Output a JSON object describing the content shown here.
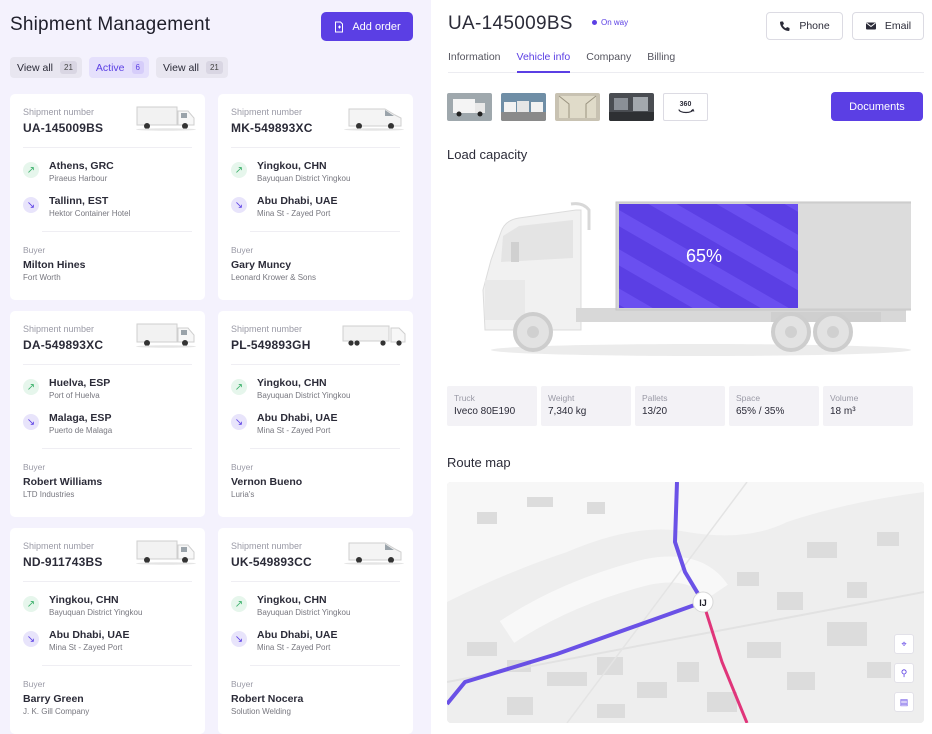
{
  "left": {
    "title": "Shipment Management",
    "add_order": "Add order",
    "filters": [
      {
        "label": "View all",
        "count": "21"
      },
      {
        "label": "Active",
        "count": "6"
      },
      {
        "label": "View all",
        "count": "21"
      }
    ],
    "shipment_label": "Shipment number",
    "buyer_label": "Buyer",
    "cards": [
      {
        "number": "UA-145009BS",
        "vehicle": "truck",
        "from_city": "Athens, GRC",
        "from_place": "Piraeus Harbour",
        "to_city": "Tallinn, EST",
        "to_place": "Hektor Container Hotel",
        "buyer": "Milton Hines",
        "company": "Fort Worth"
      },
      {
        "number": "MK-549893XC",
        "vehicle": "van",
        "from_city": "Yingkou, CHN",
        "from_place": "Bayuquan District Yingkou",
        "to_city": "Abu Dhabi, UAE",
        "to_place": "Mina St - Zayed Port",
        "buyer": "Gary Muncy",
        "company": "Leonard Krower & Sons"
      },
      {
        "number": "DA-549893XC",
        "vehicle": "truck",
        "from_city": "Huelva, ESP",
        "from_place": "Port of Huelva",
        "to_city": "Malaga, ESP",
        "to_place": "Puerto de Malaga",
        "buyer": "Robert Williams",
        "company": "LTD Industries"
      },
      {
        "number": "PL-549893GH",
        "vehicle": "semi",
        "from_city": "Yingkou, CHN",
        "from_place": "Bayuquan District Yingkou",
        "to_city": "Abu Dhabi, UAE",
        "to_place": "Mina St - Zayed Port",
        "buyer": "Vernon Bueno",
        "company": "Luria's"
      },
      {
        "number": "ND-911743BS",
        "vehicle": "truck",
        "from_city": "Yingkou, CHN",
        "from_place": "Bayuquan District Yingkou",
        "to_city": "Abu Dhabi, UAE",
        "to_place": "Mina St - Zayed Port",
        "buyer": "Barry Green",
        "company": "J. K. Gill Company"
      },
      {
        "number": "UK-549893CC",
        "vehicle": "van",
        "from_city": "Yingkou, CHN",
        "from_place": "Bayuquan District Yingkou",
        "to_city": "Abu Dhabi, UAE",
        "to_place": "Mina St - Zayed Port",
        "buyer": "Robert Nocera",
        "company": "Solution Welding"
      }
    ]
  },
  "right": {
    "id": "UA-145009BS",
    "status": "On way",
    "phone": "Phone",
    "email": "Email",
    "tabs": [
      "Information",
      "Vehicle info",
      "Company",
      "Billing"
    ],
    "active_tab": "Vehicle info",
    "thumb_360": "360",
    "documents": "Documents",
    "load_title": "Load capacity",
    "load_percent": "65%",
    "load_fraction": 0.65,
    "specs": [
      {
        "label": "Truck",
        "value": "Iveco  80E190"
      },
      {
        "label": "Weight",
        "value": "7,340 kg"
      },
      {
        "label": "Pallets",
        "value": "13/20"
      },
      {
        "label": "Space",
        "value": "65% / 35%"
      },
      {
        "label": "Volume",
        "value": "18 m³"
      }
    ],
    "route_title": "Route map",
    "map_marker": "IJ"
  },
  "colors": {
    "accent": "#5b3fe4",
    "route_done": "#5b3fe4",
    "route_next": "#e0357a",
    "success": "#3bb06a"
  }
}
